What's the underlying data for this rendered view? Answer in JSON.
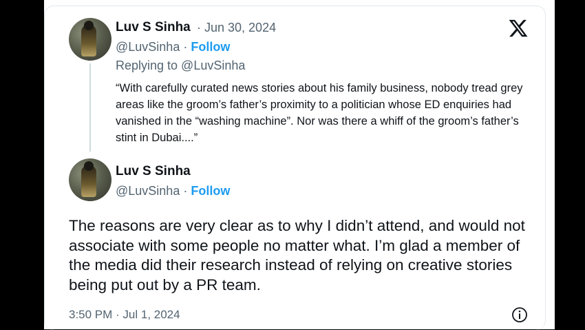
{
  "tweet1": {
    "name": "Luv S Sinha",
    "date": "· Jun 30, 2024",
    "handle": "@LuvSinha ·",
    "follow": "Follow",
    "replying_to": "Replying to @LuvSinha",
    "text": "“With carefully curated news stories about his family business, nobody tread grey areas like the groom’s father’s proximity to a politician whose ED enquiries had vanished in the “washing machine”. Nor was there a whiff of the groom’s father’s stint in Dubai....”"
  },
  "tweet2": {
    "name": "Luv S Sinha",
    "handle": "@LuvSinha ·",
    "follow": "Follow",
    "text": "The reasons are very clear as to why I didn’t attend, and would not associate with some people no matter what. I’m glad a member of the media did their research instead of relying on creative stories being put out by a PR team.",
    "timestamp": "3:50 PM · Jul 1, 2024"
  },
  "icons": {
    "logo": "x-logo-icon",
    "info": "info-icon"
  },
  "colors": {
    "link": "#1d9bf0",
    "muted": "#536471",
    "text": "#0f1419"
  }
}
